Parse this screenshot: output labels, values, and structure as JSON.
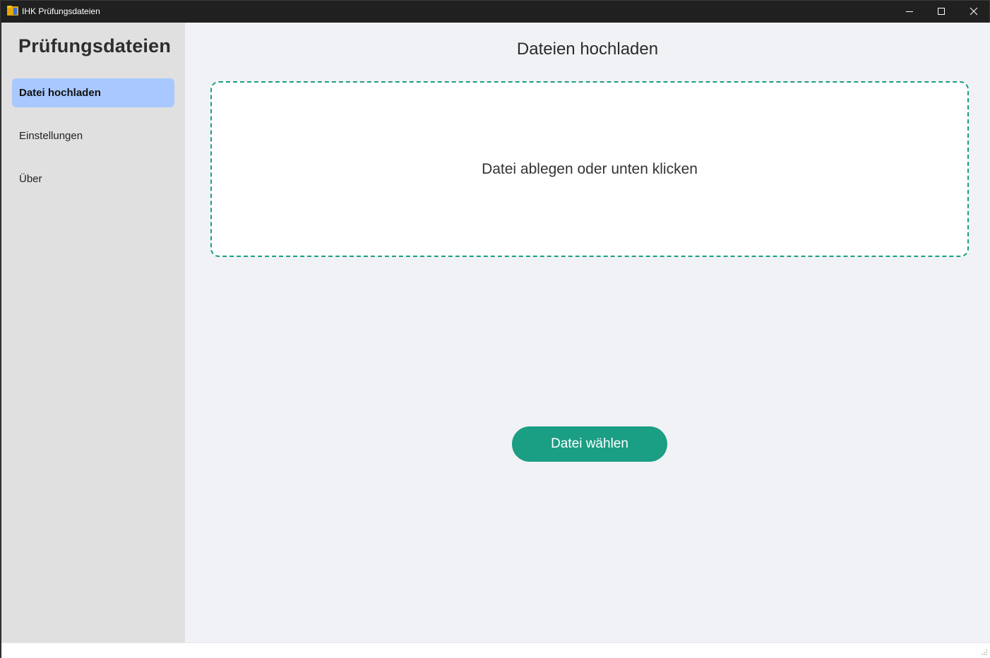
{
  "window": {
    "title": "IHK Prüfungsdateien",
    "icon": "folder-icon"
  },
  "sidebar": {
    "title": "Prüfungsdateien",
    "items": [
      {
        "label": "Datei hochladen",
        "active": true
      },
      {
        "label": "Einstellungen",
        "active": false
      },
      {
        "label": "Über",
        "active": false
      }
    ]
  },
  "main": {
    "title": "Dateien hochladen",
    "dropzone_text": "Datei ablegen oder unten klicken",
    "choose_button": "Datei wählen"
  },
  "colors": {
    "accent": "#1a9e84",
    "nav_active": "#a8c8ff",
    "sidebar_bg": "#e0e0e0",
    "content_bg": "#f0f2f5",
    "titlebar_bg": "#202020"
  }
}
